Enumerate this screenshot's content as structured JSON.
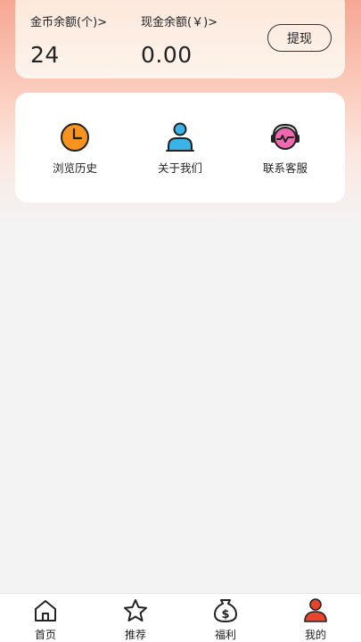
{
  "wallet": {
    "coin_label": "金币余额(个)>",
    "coin_value": "24",
    "cash_label": "现金余额(￥)>",
    "cash_value": "0.00",
    "withdraw_label": "提现"
  },
  "quick_actions": [
    {
      "label": "浏览历史",
      "icon": "clock-icon",
      "color": "#f7931e"
    },
    {
      "label": "关于我们",
      "icon": "user-icon",
      "color": "#3ab4e8"
    },
    {
      "label": "联系客服",
      "icon": "headset-icon",
      "color": "#f06ab0"
    }
  ],
  "tabbar": {
    "items": [
      {
        "label": "首页",
        "icon": "home-icon"
      },
      {
        "label": "推荐",
        "icon": "star-icon"
      },
      {
        "label": "福利",
        "icon": "dollar-bag-icon"
      },
      {
        "label": "我的",
        "icon": "profile-icon",
        "active": true
      }
    ],
    "active_color": "#e8452c"
  }
}
